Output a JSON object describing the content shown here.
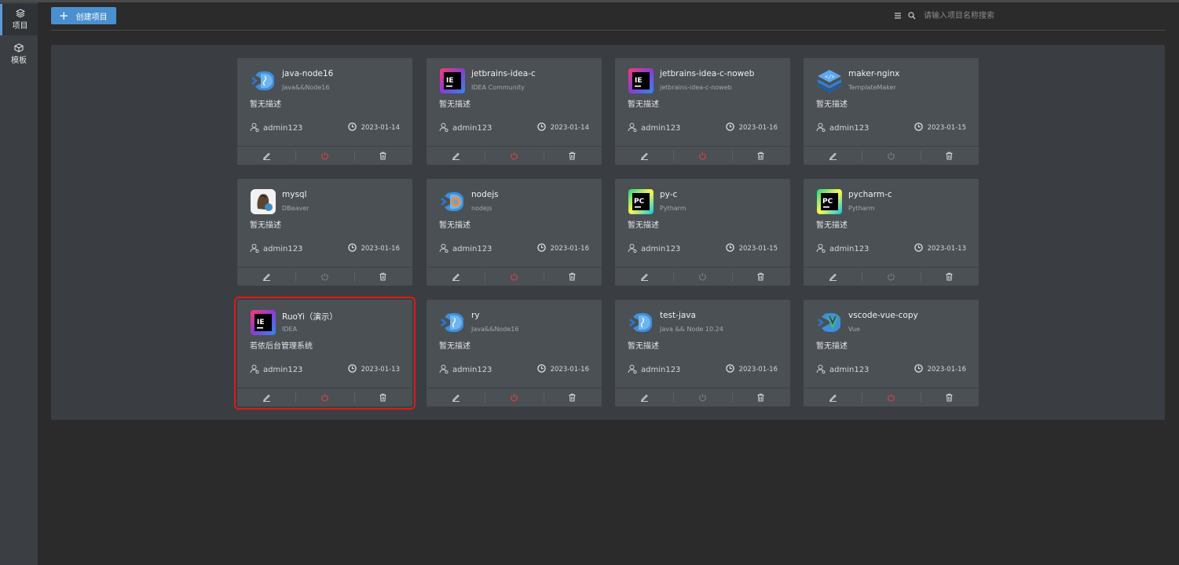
{
  "sidebar": {
    "items": [
      {
        "label": "项目",
        "icon": "layers-icon",
        "active": true
      },
      {
        "label": "模板",
        "icon": "box-icon",
        "active": false
      }
    ]
  },
  "toolbar": {
    "create_label": "创建项目",
    "search_placeholder": "请输入项目名称搜索"
  },
  "colors": {
    "accent": "#4a90d0",
    "highlight": "#e0191a",
    "stop_active": "#e04040",
    "stop_inactive": "#7a7f84"
  },
  "cards": [
    {
      "name": "java-node16",
      "sub": "Java&&Node16",
      "desc": "暂无描述",
      "user": "admin123",
      "date": "2023-01-14",
      "logo": "vscode-java-icon",
      "running": true
    },
    {
      "name": "jetbrains-idea-c",
      "sub": "IDEA Community",
      "desc": "暂无描述",
      "user": "admin123",
      "date": "2023-01-14",
      "logo": "intellij-idea-icon",
      "running": true
    },
    {
      "name": "jetbrains-idea-c-noweb",
      "sub": "jetbrains-idea-c-noweb",
      "desc": "暂无描述",
      "user": "admin123",
      "date": "2023-01-16",
      "logo": "intellij-idea-icon",
      "running": true
    },
    {
      "name": "maker-nginx",
      "sub": "TemplateMaker",
      "desc": "暂无描述",
      "user": "admin123",
      "date": "2023-01-15",
      "logo": "template-maker-icon",
      "running": false
    },
    {
      "name": "mysql",
      "sub": "DBeaver",
      "desc": "暂无描述",
      "user": "admin123",
      "date": "2023-01-16",
      "logo": "dbeaver-icon",
      "running": false
    },
    {
      "name": "nodejs",
      "sub": "nodejs",
      "desc": "暂无描述",
      "user": "admin123",
      "date": "2023-01-16",
      "logo": "vscode-node-icon",
      "running": true
    },
    {
      "name": "py-c",
      "sub": "Pytharm",
      "desc": "暂无描述",
      "user": "admin123",
      "date": "2023-01-15",
      "logo": "pycharm-icon",
      "running": false
    },
    {
      "name": "pycharm-c",
      "sub": "Pytharm",
      "desc": "暂无描述",
      "user": "admin123",
      "date": "2023-01-13",
      "logo": "pycharm-icon",
      "running": false
    },
    {
      "name": "RuoYi（演示）",
      "sub": "IDEA",
      "desc": "若依后台管理系统",
      "user": "admin123",
      "date": "2023-01-13",
      "logo": "intellij-idea-icon",
      "running": true,
      "highlighted": true
    },
    {
      "name": "ry",
      "sub": "Java&&Node16",
      "desc": "暂无描述",
      "user": "admin123",
      "date": "2023-01-16",
      "logo": "vscode-java-icon",
      "running": true
    },
    {
      "name": "test-java",
      "sub": "Java && Node 10.24",
      "desc": "暂无描述",
      "user": "admin123",
      "date": "2023-01-16",
      "logo": "vscode-java-icon",
      "running": false
    },
    {
      "name": "vscode-vue-copy",
      "sub": "Vue",
      "desc": "暂无描述",
      "user": "admin123",
      "date": "2023-01-16",
      "logo": "vscode-vue-icon",
      "running": true
    }
  ]
}
